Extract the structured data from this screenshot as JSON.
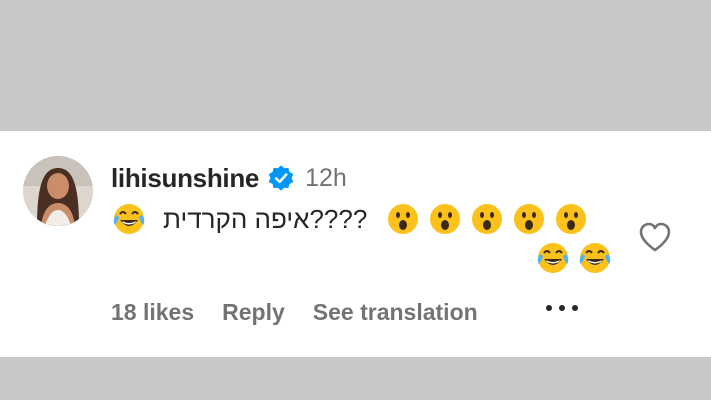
{
  "comment": {
    "username": "lihisunshine",
    "verified": true,
    "time_ago": "12h",
    "text": "איפה הקרדית????",
    "leading_emoji": "face-with-tears-of-joy",
    "trailing_emojis": [
      "face-with-open-mouth",
      "face-with-open-mouth",
      "face-with-open-mouth",
      "face-with-open-mouth",
      "face-with-open-mouth",
      "face-with-tears-of-joy",
      "face-with-tears-of-joy"
    ],
    "likes_label": "18 likes",
    "reply_label": "Reply",
    "translate_label": "See translation",
    "more_icon": "more-horizontal-icon",
    "like_icon": "heart-outline-icon"
  },
  "colors": {
    "text_primary": "#262626",
    "text_secondary": "#737373",
    "verified_blue": "#0095f6",
    "background": "#ffffff",
    "outer_background": "#c8c8c8"
  }
}
